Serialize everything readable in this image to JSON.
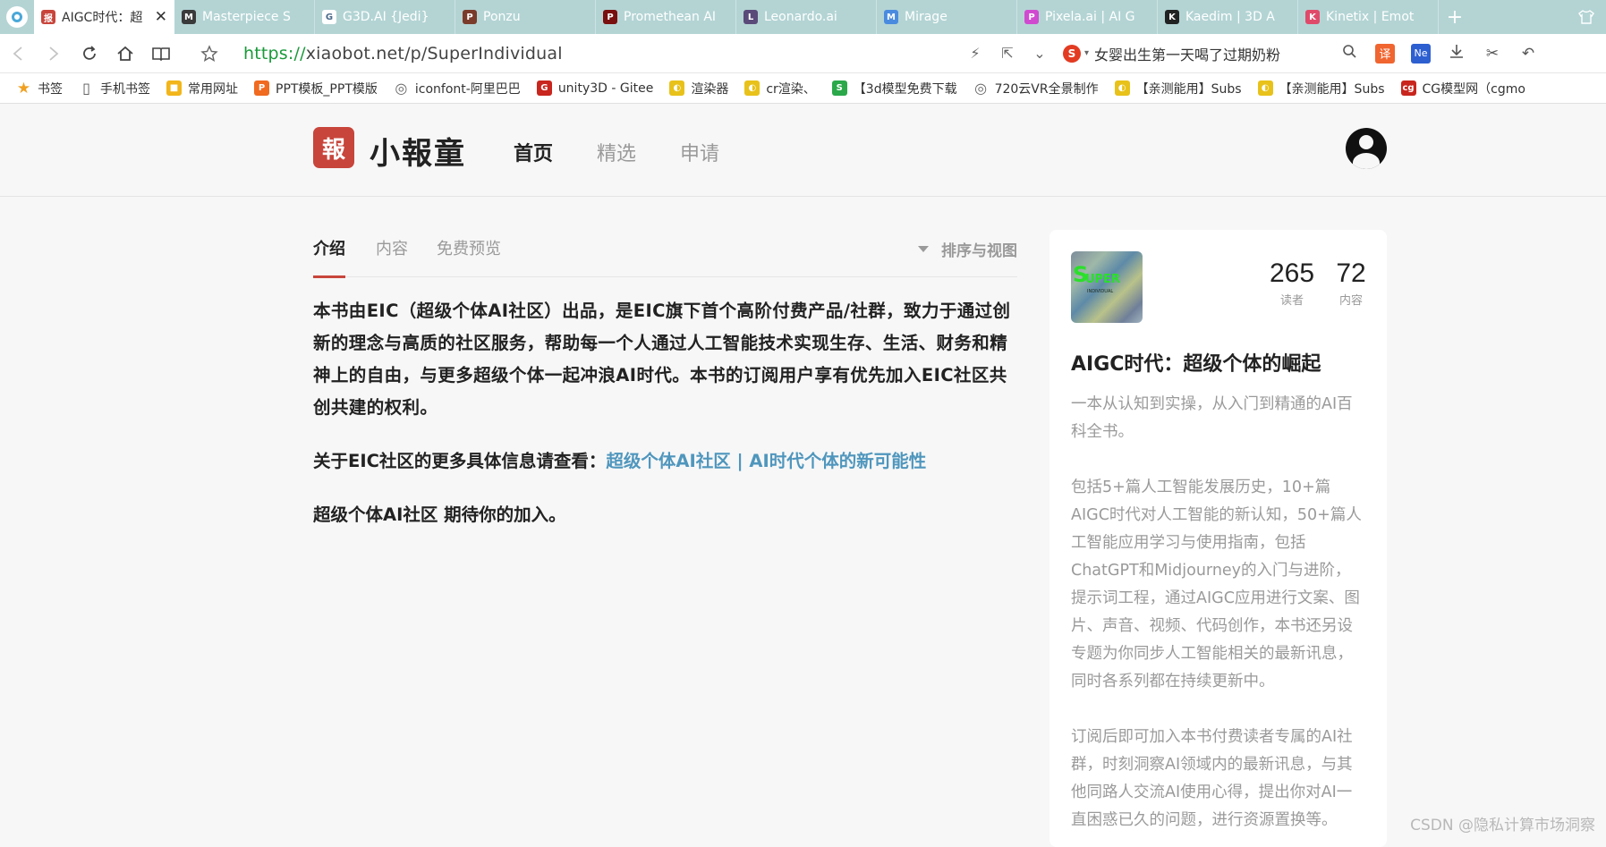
{
  "browser": {
    "tabs": [
      {
        "title": "AIGC时代：超",
        "favicon": "报",
        "color": "#c8453b",
        "active": true
      },
      {
        "title": "Masterpiece S",
        "favicon": "M",
        "color": "#3a3a3a",
        "active": false
      },
      {
        "title": "G3D.AI {Jedi}",
        "favicon": "G",
        "color": "#ffffff",
        "active": false
      },
      {
        "title": "Ponzu",
        "favicon": "P",
        "color": "#7a3b2a",
        "active": false
      },
      {
        "title": "Promethean AI",
        "favicon": "P",
        "color": "#7a0f0f",
        "active": false
      },
      {
        "title": "Leonardo.ai",
        "favicon": "L",
        "color": "#5a4a7a",
        "active": false
      },
      {
        "title": "Mirage",
        "favicon": "M",
        "color": "#4a8be0",
        "active": false
      },
      {
        "title": "Pixela.ai | AI G",
        "favicon": "P",
        "color": "#d04ad0",
        "active": false
      },
      {
        "title": "Kaedim | 3D A",
        "favicon": "K",
        "color": "#222222",
        "active": false
      },
      {
        "title": "Kinetix | Emot",
        "favicon": "K",
        "color": "#e04a6a",
        "active": false
      }
    ],
    "new_tab_label": "+",
    "url_scheme": "https://",
    "url_rest": "xiaobot.net/p/SuperIndividual",
    "search_suggestion": "女婴出生第一天喝了过期奶粉",
    "translate_label": "译",
    "bookmarks": [
      {
        "label": "书签",
        "color": "#f0a020",
        "icon": "★"
      },
      {
        "label": "手机书签",
        "color": "#555555",
        "icon": "▯"
      },
      {
        "label": "常用网址",
        "color": "#f2b51a",
        "icon": "■"
      },
      {
        "label": "PPT模板_PPT模版",
        "color": "#f06a20",
        "icon": "P"
      },
      {
        "label": "iconfont-阿里巴巴",
        "color": "#666666",
        "icon": "◎"
      },
      {
        "label": "unity3D - Gitee",
        "color": "#c8261e",
        "icon": "G"
      },
      {
        "label": "渲染器",
        "color": "#e8c21a",
        "icon": "◐"
      },
      {
        "label": "cr渲染、",
        "color": "#e8c21a",
        "icon": "◐"
      },
      {
        "label": "【3d模型免费下载",
        "color": "#2aa84a",
        "icon": "S"
      },
      {
        "label": "720云VR全景制作",
        "color": "#666666",
        "icon": "◎"
      },
      {
        "label": "【亲测能用】Subs",
        "color": "#e8c21a",
        "icon": "◐"
      },
      {
        "label": "【亲测能用】Subs",
        "color": "#e8c21a",
        "icon": "◐"
      },
      {
        "label": "CG模型网（cgmo",
        "color": "#c8261e",
        "icon": "cg"
      }
    ]
  },
  "site": {
    "logo_char": "報",
    "logo_text": "小報童",
    "nav": [
      "首页",
      "精选",
      "申请"
    ]
  },
  "content": {
    "tabs": [
      "介绍",
      "内容",
      "免费预览"
    ],
    "sort_label": "排序与视图",
    "intro": "本书由EIC（超级个体AI社区）出品，是EIC旗下首个高阶付费产品/社群，致力于通过创新的理念与高质的社区服务，帮助每一个人通过人工智能技术实现生存、生活、财务和精神上的自由，与更多超级个体一起冲浪AI时代。本书的订阅用户享有优先加入EIC社区共创共建的权利。",
    "more_prefix": "关于EIC社区的更多具体信息请查看：",
    "more_link": "超级个体AI社区 | AI时代个体的新可能性",
    "closing": "超级个体AI社区 期待你的加入。"
  },
  "card": {
    "readers_count": "265",
    "readers_label": "读者",
    "contents_count": "72",
    "contents_label": "内容",
    "title": "AIGC时代：超级个体的崛起",
    "desc": [
      "一本从认知到实操，从入门到精通的AI百科全书。",
      "包括5+篇人工智能发展历史，10+篇AIGC时代对人工智能的新认知，50+篇人工智能应用学习与使用指南，包括ChatGPT和Midjourney的入门与进阶，提示词工程，通过AIGC应用进行文案、图片、声音、视频、代码创作，本书还另设专题为你同步人工智能相关的最新讯息，同时各系列都在持续更新中。",
      "订阅后即可加入本书付费读者专属的AI社群，时刻洞察AI领域内的最新讯息，与其他同路人交流AI使用心得，提出你对AI一直困惑已久的问题，进行资源置换等。"
    ]
  },
  "watermark": "CSDN @隐私计算市场洞察"
}
